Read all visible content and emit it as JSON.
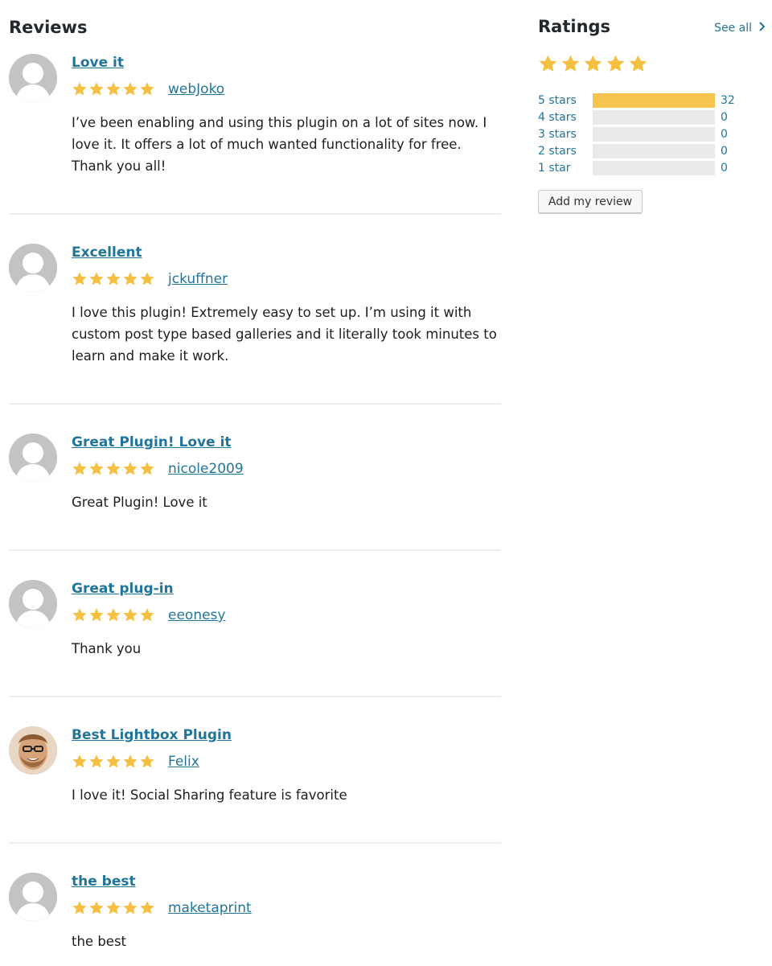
{
  "reviews_section": {
    "title": "Reviews",
    "items": [
      {
        "title": "Love it",
        "author": "webJoko",
        "stars": 5,
        "avatar": "default-avatar",
        "text": "I’ve been enabling and using this plugin on a lot of sites now. I love it. It offers a lot of much wanted functionality for free. Thank you all!"
      },
      {
        "title": "Excellent",
        "author": "jckuffner",
        "stars": 5,
        "avatar": "default-avatar",
        "text": "I love this plugin! Extremely easy to set up. I’m using it with custom post type based galleries and it literally took minutes to learn and make it work."
      },
      {
        "title": "Great Plugin! Love it",
        "author": "nicole2009",
        "stars": 5,
        "avatar": "default-avatar",
        "text": "Great Plugin! Love it"
      },
      {
        "title": "Great plug-in",
        "author": "eeonesy",
        "stars": 5,
        "avatar": "default-avatar",
        "text": "Thank you"
      },
      {
        "title": "Best Lightbox Plugin",
        "author": "Felix",
        "stars": 5,
        "avatar": "user-photo-avatar",
        "text": "I love it! Social Sharing feature is favorite"
      },
      {
        "title": "the best",
        "author": "maketaprint",
        "stars": 5,
        "avatar": "default-avatar",
        "text": "the best"
      }
    ]
  },
  "ratings": {
    "title": "Ratings",
    "see_all": "See all",
    "overall_stars": 5,
    "rows": [
      {
        "label": "5 stars",
        "count": "32",
        "fraction": 1.0
      },
      {
        "label": "4 stars",
        "count": "0",
        "fraction": 0
      },
      {
        "label": "3 stars",
        "count": "0",
        "fraction": 0
      },
      {
        "label": "2 stars",
        "count": "0",
        "fraction": 0
      },
      {
        "label": "1 star",
        "count": "0",
        "fraction": 0
      }
    ],
    "add_review_label": "Add my review"
  },
  "colors": {
    "link": "#21759b",
    "star": "#f5bf42",
    "bar_fill": "#f5c550",
    "bar_track": "#eaeaea",
    "avatar_bg": "#c3c3c3"
  }
}
